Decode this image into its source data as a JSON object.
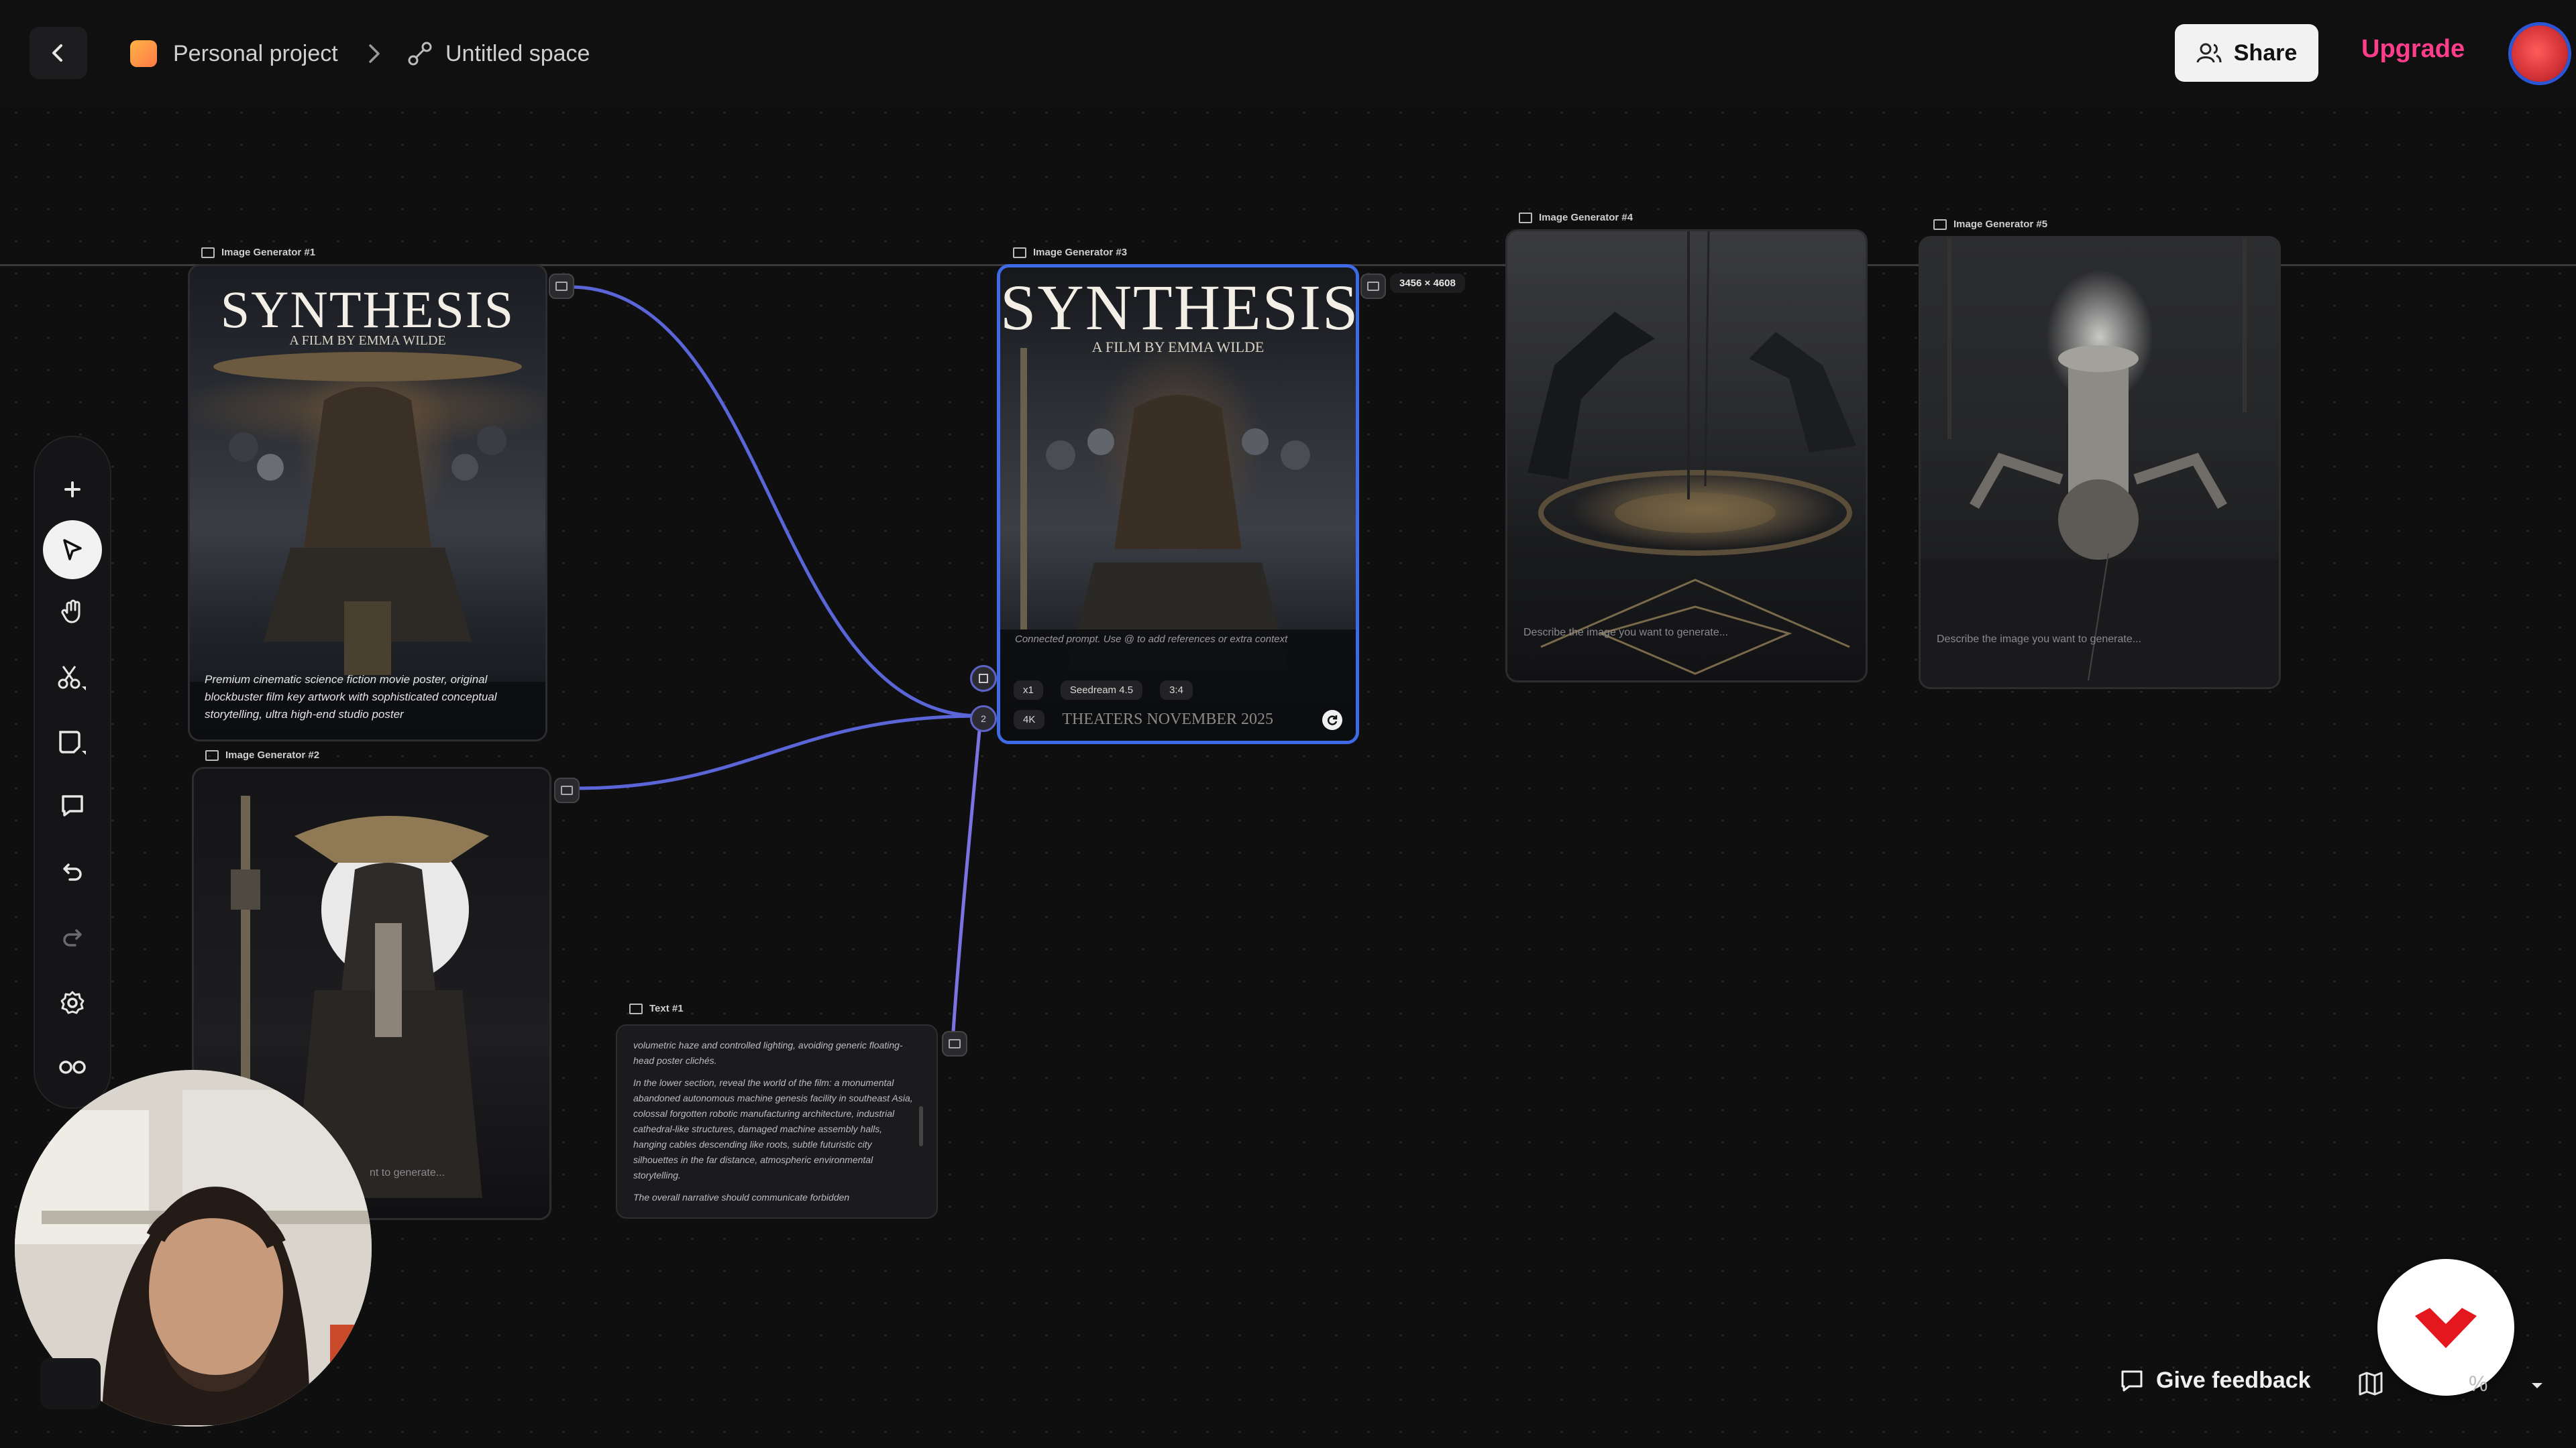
{
  "topbar": {
    "project": "Personal project",
    "space": "Untitled space",
    "share_label": "Share",
    "upgrade_label": "Upgrade"
  },
  "toolbar": {
    "tools": [
      "plus-icon",
      "pointer-icon",
      "hand-icon",
      "scissors-icon",
      "frame-icon",
      "comment-icon",
      "undo-icon",
      "redo-icon",
      "settings-icon",
      "link-icon"
    ]
  },
  "nodes": {
    "gen1": {
      "label": "Image Generator #1",
      "poster_title": "SYNTHESIS",
      "poster_sub": "A FILM BY EMMA WILDE",
      "prompt": "Premium cinematic science fiction movie poster, original blockbuster film key artwork with sophisticated conceptual storytelling, ultra high-end studio poster"
    },
    "gen2": {
      "label": "Image Generator #2",
      "placeholder": "nt to generate..."
    },
    "gen3": {
      "label": "Image Generator #3",
      "poster_title": "SYNTHESIS",
      "poster_sub": "A FILM BY EMMA WILDE",
      "resolution": "3456 × 4608",
      "connected_prompt": "Connected prompt. Use @ to add references or extra context",
      "tagline": "THEATERS NOVEMBER 2025",
      "controls": {
        "count": "x1",
        "model": "Seedream 4.5",
        "ratio": "3:4",
        "quality": "4K"
      }
    },
    "gen4": {
      "label": "Image Generator #4",
      "placeholder": "Describe the image you want to generate..."
    },
    "gen5": {
      "label": "Image Generator #5",
      "placeholder": "Describe the image you want to generate..."
    },
    "text1": {
      "label": "Text #1",
      "paragraphs": [
        "volumetric haze and controlled lighting, avoiding generic floating-head poster clichés.",
        "In the lower section, reveal the world of the film: a monumental abandoned autonomous machine genesis facility in southeast Asia, colossal forgotten robotic manufacturing architecture, industrial cathedral-like structures, damaged machine assembly halls, hanging cables descending like roots, subtle futuristic city silhouettes in the far distance, atmospheric environmental storytelling.",
        "The overall narrative should communicate forbidden"
      ]
    }
  },
  "ports": {
    "input_count": "2"
  },
  "bottom": {
    "feedback_label": "Give feedback",
    "zoom": "%"
  },
  "colors": {
    "accent": "#3e6ae6",
    "edge": "#5a66d8",
    "upgrade": "#ff3d8b",
    "brand": "#e3171d"
  }
}
